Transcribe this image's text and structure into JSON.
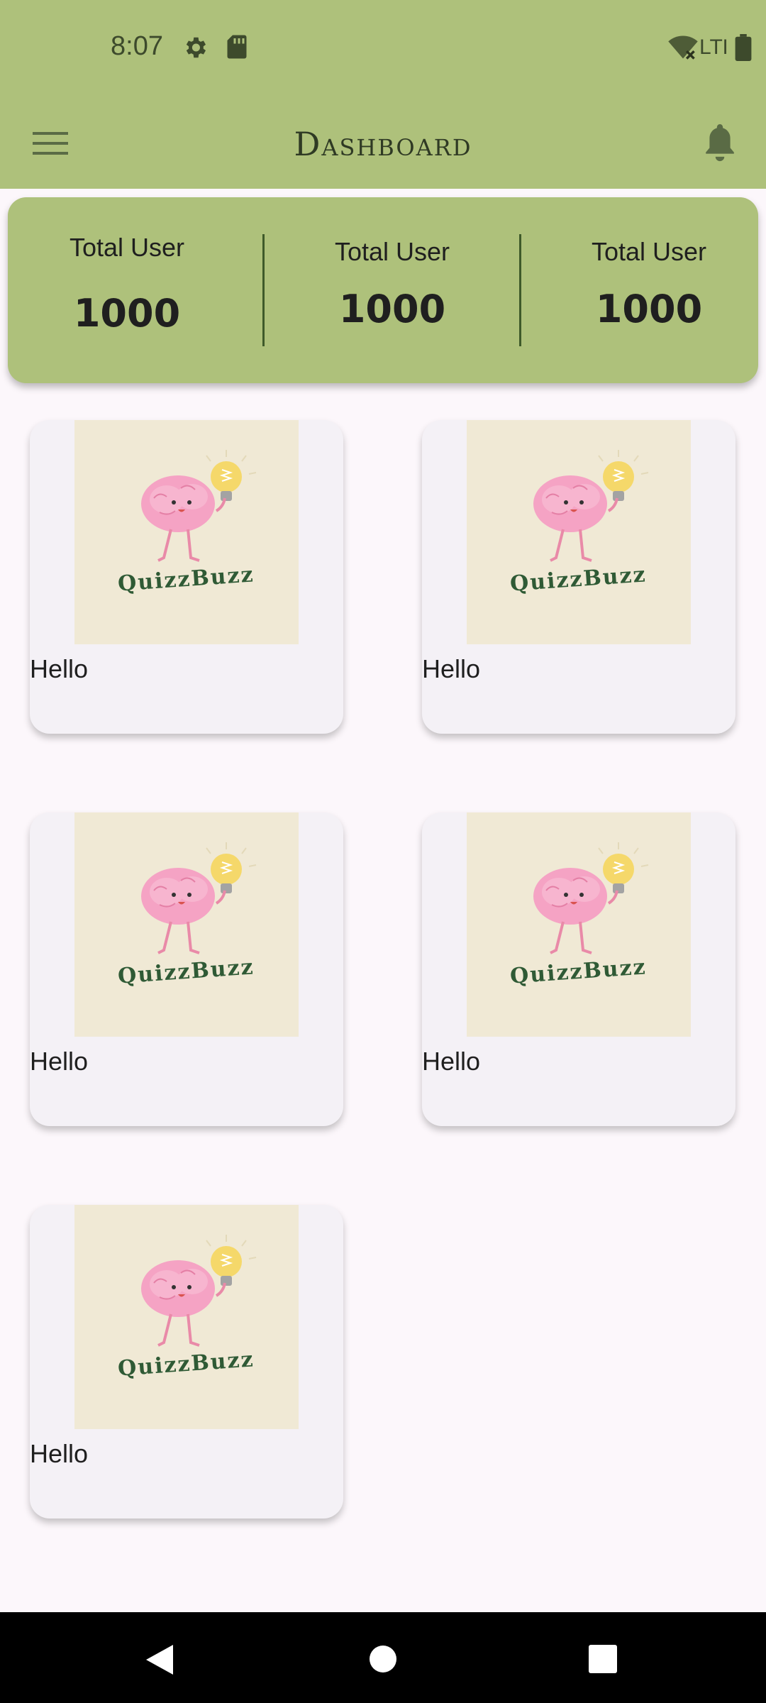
{
  "status_bar": {
    "time": "8:07",
    "network": "LTE",
    "icons": [
      "settings-icon",
      "sd-card-icon",
      "wifi-icon",
      "battery-icon"
    ]
  },
  "app_bar": {
    "title": "Dashboard",
    "icons": [
      "menu-icon",
      "bell-icon"
    ]
  },
  "stats": [
    {
      "label": "Total User",
      "value": "1000"
    },
    {
      "label": "Total User",
      "value": "1000"
    },
    {
      "label": "Total User",
      "value": "1000"
    }
  ],
  "cards": [
    {
      "logo_text": "QuizzBuzz",
      "caption": "Hello"
    },
    {
      "logo_text": "QuizzBuzz",
      "caption": "Hello"
    },
    {
      "logo_text": "QuizzBuzz",
      "caption": "Hello"
    },
    {
      "logo_text": "QuizzBuzz",
      "caption": "Hello"
    },
    {
      "logo_text": "QuizzBuzz",
      "caption": "Hello"
    }
  ],
  "colors": {
    "app_bar": "#aec17b",
    "background": "#fcf7fb",
    "card": "#f4f1f6",
    "thumb": "#f0e9d5",
    "logo_text": "#2f5a35"
  }
}
